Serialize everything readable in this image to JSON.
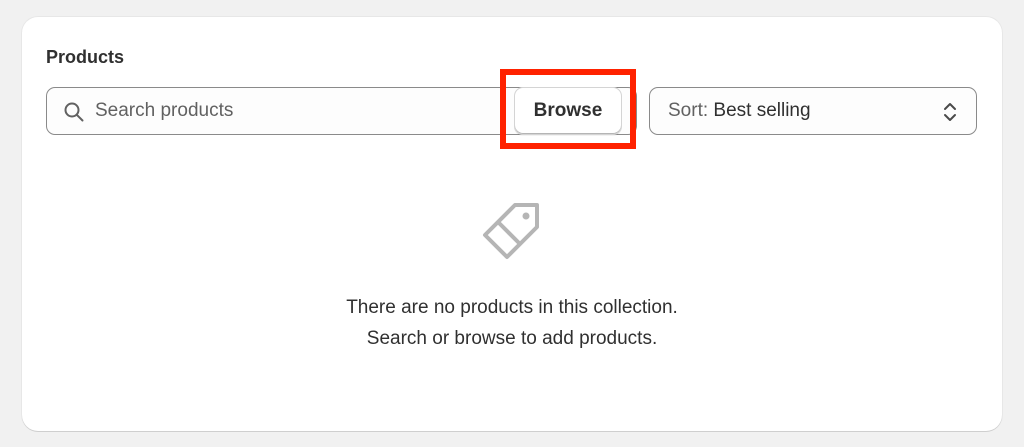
{
  "products_card": {
    "title": "Products",
    "search": {
      "placeholder": "Search products",
      "value": "",
      "icon": "search-icon"
    },
    "browse_button": {
      "label": "Browse",
      "highlight_color": "#ff2200"
    },
    "sort": {
      "prefix": "Sort:",
      "selected": "Best selling",
      "icon": "chevron-up-down-icon"
    },
    "empty_state": {
      "icon": "tag-icon",
      "line1": "There are no products in this collection.",
      "line2": "Search or browse to add products."
    }
  },
  "colors": {
    "page_background": "#f1f1f1",
    "card_background": "#ffffff",
    "text_primary": "#303030",
    "text_secondary": "#616161",
    "border": "#8a8a8a",
    "icon_muted": "#b5b5b5"
  }
}
